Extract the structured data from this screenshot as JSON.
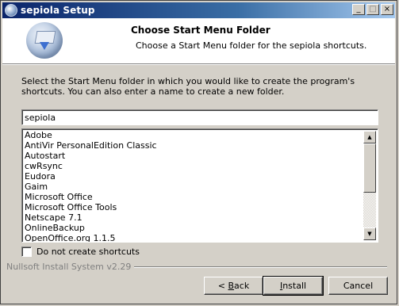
{
  "window": {
    "title": "sepiola Setup",
    "minimize_glyph": "_",
    "maximize_glyph": "□",
    "close_glyph": "×"
  },
  "header": {
    "title": "Choose Start Menu Folder",
    "subtitle": "Choose a Start Menu folder for the sepiola shortcuts."
  },
  "body": {
    "description": "Select the Start Menu folder in which you would like to create the program's shortcuts. You can also enter a name to create a new folder.",
    "folder_value": "sepiola",
    "folders": [
      "Adobe",
      "AntiVir PersonalEdition Classic",
      "Autostart",
      "cwRsync",
      "Eudora",
      "Gaim",
      "Microsoft Office",
      "Microsoft Office Tools",
      "Netscape 7.1",
      "OnlineBackup",
      "OpenOffice.org 1.1.5"
    ],
    "no_shortcuts_label": "Do not create shortcuts",
    "no_shortcuts_checked": false
  },
  "footer": {
    "brand": "Nullsoft Install System v2.29",
    "back_prefix": "< ",
    "back_accel": "B",
    "back_rest": "ack",
    "install_accel": "I",
    "install_rest": "nstall",
    "cancel_label": "Cancel"
  }
}
